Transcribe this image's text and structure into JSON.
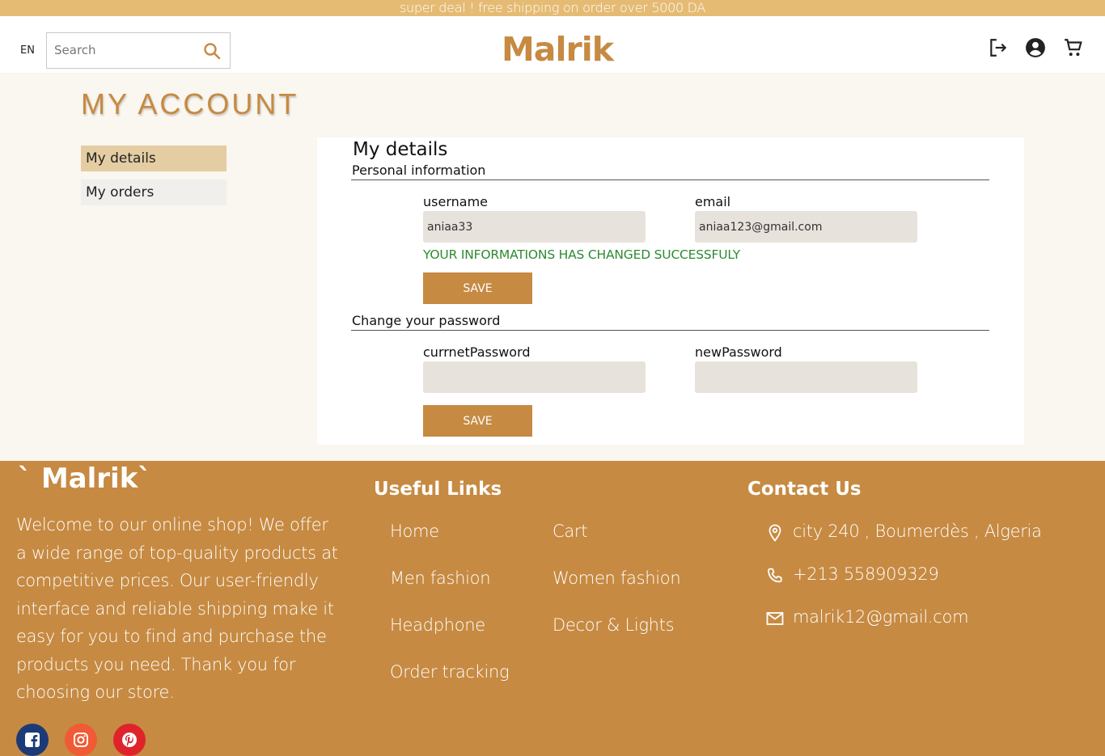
{
  "promo": {
    "text": "super deal ! free shipping on order over 5000 DA"
  },
  "header": {
    "lang": "EN",
    "search_placeholder": "Search",
    "logo": "Malrik",
    "icons": [
      "logout-icon",
      "account-icon",
      "cart-icon"
    ]
  },
  "page": {
    "title": "MY ACCOUNT"
  },
  "sidebar": {
    "items": [
      {
        "label": "My details",
        "active": true
      },
      {
        "label": "My orders",
        "active": false
      }
    ]
  },
  "details": {
    "title": "My details",
    "personal": {
      "heading": "Personal information",
      "username_label": "username",
      "username_value": "aniaa33",
      "email_label": "email",
      "email_value": "aniaa123@gmail.com",
      "success": "YOUR INFORMATIONS HAS CHANGED SUCCESSFULY",
      "save": "SAVE"
    },
    "password": {
      "heading": "Change your password",
      "current_label": "currnetPassword",
      "current_value": "",
      "new_label": "newPassword",
      "new_value": "",
      "save": "SAVE"
    }
  },
  "footer": {
    "logo": "` Malrik`",
    "about": "Welcome to our online shop! We offer a wide range of top-quality products at competitive prices. Our user-friendly interface and reliable shipping make it easy for you to find and purchase the products you need. Thank you for choosing our store.",
    "links_heading": "Useful Links",
    "links": [
      "Home",
      "Cart",
      "Men fashion",
      "Women fashion",
      "Headphone",
      "Decor & Lights",
      "Order tracking"
    ],
    "contact_heading": "Contact Us",
    "address": "city 240 , Boumerdès , Algeria",
    "phone": "+213 558909329",
    "email": "malrik12@gmail.com",
    "social": [
      "facebook-icon",
      "instagram-icon",
      "pinterest-icon"
    ]
  },
  "colors": {
    "accent": "#c68a42",
    "promo": "#e5bb74",
    "success": "#2d8a30",
    "field": "#e8e2dc",
    "sidebar_active": "#e5cda3"
  }
}
